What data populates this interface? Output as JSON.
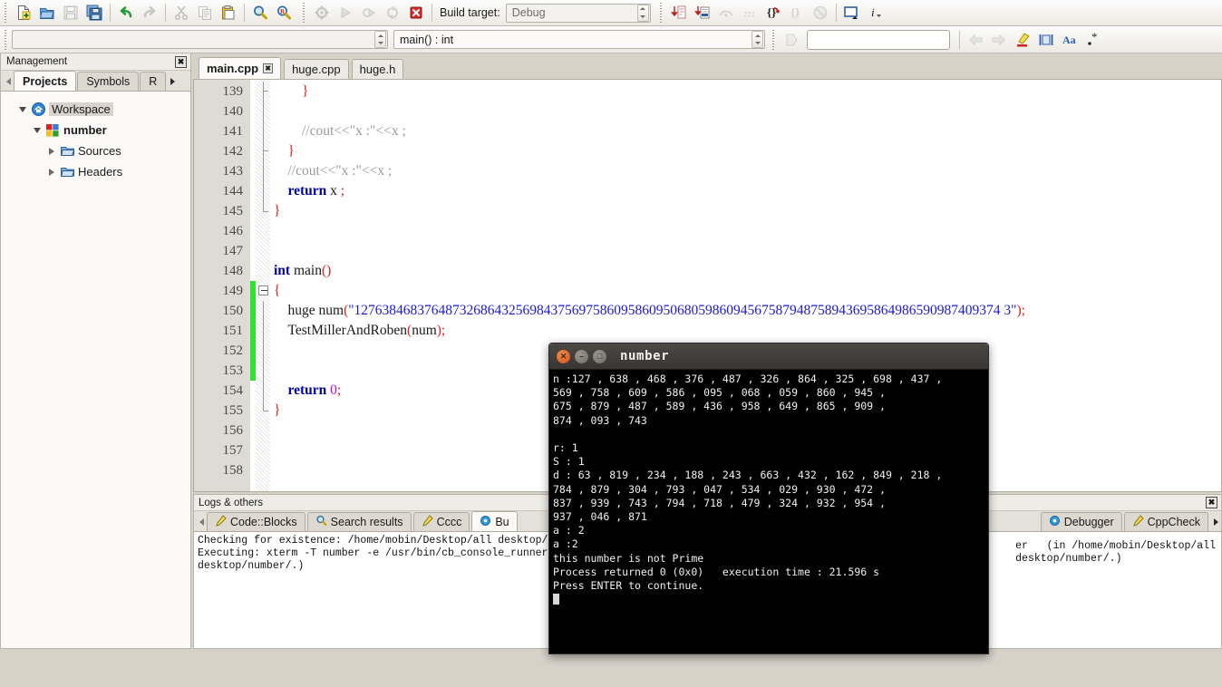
{
  "toolbar_main": {
    "buttons": [
      {
        "name": "new-file-button",
        "icon": "new-file-icon",
        "disabled": false
      },
      {
        "name": "open-file-button",
        "icon": "open-folder-icon",
        "disabled": false
      },
      {
        "name": "save-button",
        "icon": "save-icon",
        "disabled": true
      },
      {
        "name": "save-all-button",
        "icon": "save-all-icon",
        "disabled": false
      },
      {
        "name": "undo-button",
        "icon": "undo-arrow-icon",
        "disabled": false
      },
      {
        "name": "redo-button",
        "icon": "redo-arrow-icon",
        "disabled": true
      },
      {
        "name": "cut-button",
        "icon": "scissors-icon",
        "disabled": true
      },
      {
        "name": "copy-button",
        "icon": "copy-icon",
        "disabled": true
      },
      {
        "name": "paste-button",
        "icon": "clipboard-paste-icon",
        "disabled": false
      },
      {
        "name": "find-button",
        "icon": "magnifier-icon",
        "disabled": false
      },
      {
        "name": "replace-button",
        "icon": "find-replace-icon",
        "disabled": false
      }
    ],
    "build_buttons": [
      {
        "name": "build-button",
        "icon": "gear-icon",
        "disabled": true
      },
      {
        "name": "run-button",
        "icon": "play-triangle-icon",
        "disabled": true
      },
      {
        "name": "build-and-run-button",
        "icon": "gear-play-icon",
        "disabled": true
      },
      {
        "name": "rebuild-button",
        "icon": "rebuild-icon",
        "disabled": true
      },
      {
        "name": "abort-button",
        "icon": "stop-red-x-icon",
        "disabled": false
      }
    ],
    "build_target_label": "Build target:",
    "build_target_value": "Debug",
    "debug_buttons": [
      {
        "name": "debug-continue-button",
        "icon": "debug-continue-icon",
        "disabled": false
      },
      {
        "name": "debug-run-to-cursor-button",
        "icon": "run-to-cursor-icon",
        "disabled": false
      },
      {
        "name": "debug-next-line-button",
        "icon": "step-over-icon",
        "disabled": true
      },
      {
        "name": "debug-next-instruction-button",
        "icon": "step-instruction-icon",
        "disabled": true
      },
      {
        "name": "debug-step-into-button",
        "icon": "step-into-icon",
        "disabled": false
      },
      {
        "name": "debug-step-out-button",
        "icon": "step-out-icon",
        "disabled": true
      },
      {
        "name": "debug-stop-button",
        "icon": "stop-debugger-icon",
        "disabled": true
      },
      {
        "name": "debug-windows-button",
        "icon": "debug-window-icon",
        "disabled": false
      },
      {
        "name": "debug-info-button",
        "icon": "info-icon",
        "disabled": false
      }
    ]
  },
  "toolbar_secondary": {
    "scope_value": "",
    "scope_placeholder": "",
    "function_value": "main() : int",
    "goto_button": "goto-icon",
    "search_value": "",
    "search_placeholder": "",
    "right_buttons": [
      {
        "name": "nav-back-button",
        "icon": "arrow-left-icon",
        "disabled": true
      },
      {
        "name": "nav-forward-button",
        "icon": "arrow-right-icon",
        "disabled": true
      },
      {
        "name": "highlight-button",
        "icon": "highlighter-pen-icon",
        "disabled": false
      },
      {
        "name": "whole-word-button",
        "icon": "whole-word-icon",
        "disabled": false
      },
      {
        "name": "match-case-button",
        "icon": "match-case-icon",
        "disabled": false
      },
      {
        "name": "regex-button",
        "icon": "regex-icon",
        "disabled": false
      }
    ]
  },
  "management": {
    "caption": "Management",
    "close_icon": "close-icon",
    "tabs": [
      {
        "label": "Projects",
        "active": true
      },
      {
        "label": "Symbols",
        "active": false
      },
      {
        "label": "R",
        "active": false
      }
    ],
    "tree": [
      {
        "label": "Workspace",
        "icon": "workspace-home-icon",
        "depth": 0,
        "twisty": "down",
        "selected": true,
        "bold": false
      },
      {
        "label": "number",
        "icon": "project-squares-icon",
        "depth": 1,
        "twisty": "down",
        "selected": false,
        "bold": true
      },
      {
        "label": "Sources",
        "icon": "folder-icon",
        "depth": 2,
        "twisty": "right",
        "selected": false,
        "bold": false
      },
      {
        "label": "Headers",
        "icon": "folder-icon",
        "depth": 2,
        "twisty": "right",
        "selected": false,
        "bold": false
      }
    ]
  },
  "editor": {
    "tabs": [
      {
        "label": "main.cpp",
        "active": true,
        "closable": true
      },
      {
        "label": "huge.cpp",
        "active": false,
        "closable": false
      },
      {
        "label": "huge.h",
        "active": false,
        "closable": false
      }
    ],
    "first_line_number": 139,
    "lines": [
      {
        "n": 139,
        "changed": false,
        "fold": "end-inner",
        "tokens": [
          {
            "t": "        ",
            "c": "id"
          },
          {
            "t": "}",
            "c": "br"
          }
        ]
      },
      {
        "n": 140,
        "changed": false,
        "fold": "line",
        "tokens": []
      },
      {
        "n": 141,
        "changed": false,
        "fold": "line",
        "tokens": [
          {
            "t": "        //cout<<\"x :\"<<x ;",
            "c": "cm"
          }
        ]
      },
      {
        "n": 142,
        "changed": false,
        "fold": "end-inner",
        "tokens": [
          {
            "t": "    ",
            "c": "id"
          },
          {
            "t": "}",
            "c": "br"
          }
        ]
      },
      {
        "n": 143,
        "changed": false,
        "fold": "line",
        "tokens": [
          {
            "t": "    //cout<<\"x :\"<<x ;",
            "c": "cm"
          }
        ]
      },
      {
        "n": 144,
        "changed": false,
        "fold": "line",
        "tokens": [
          {
            "t": "    ",
            "c": "id"
          },
          {
            "t": "return",
            "c": "kw"
          },
          {
            "t": " x ",
            "c": "id"
          },
          {
            "t": ";",
            "c": "br"
          }
        ]
      },
      {
        "n": 145,
        "changed": false,
        "fold": "end-outer",
        "tokens": [
          {
            "t": "",
            "c": "id"
          },
          {
            "t": "}",
            "c": "br"
          }
        ]
      },
      {
        "n": 146,
        "changed": false,
        "fold": "none",
        "tokens": []
      },
      {
        "n": 147,
        "changed": false,
        "fold": "none",
        "tokens": []
      },
      {
        "n": 148,
        "changed": false,
        "fold": "none",
        "tokens": [
          {
            "t": "int",
            "c": "kw"
          },
          {
            "t": " main",
            "c": "id"
          },
          {
            "t": "()",
            "c": "br"
          }
        ]
      },
      {
        "n": 149,
        "changed": true,
        "fold": "start",
        "tokens": [
          {
            "t": "{",
            "c": "br"
          }
        ]
      },
      {
        "n": 150,
        "changed": true,
        "fold": "line",
        "tokens": [
          {
            "t": "    huge num",
            "c": "id"
          },
          {
            "t": "(",
            "c": "br"
          },
          {
            "t": "\"12763846837648732686432569843756975860958609506805986094567587948758943695864986590987409374 3\"",
            "c": "str"
          },
          {
            "t": ");",
            "c": "br"
          }
        ]
      },
      {
        "n": 151,
        "changed": true,
        "fold": "line",
        "tokens": [
          {
            "t": "    TestMillerAndRoben",
            "c": "id"
          },
          {
            "t": "(",
            "c": "br"
          },
          {
            "t": "num",
            "c": "id"
          },
          {
            "t": ");",
            "c": "br"
          }
        ]
      },
      {
        "n": 152,
        "changed": true,
        "fold": "line",
        "tokens": []
      },
      {
        "n": 153,
        "changed": true,
        "fold": "line",
        "tokens": []
      },
      {
        "n": 154,
        "changed": false,
        "fold": "line",
        "tokens": [
          {
            "t": "    ",
            "c": "id"
          },
          {
            "t": "return",
            "c": "kw"
          },
          {
            "t": " ",
            "c": "id"
          },
          {
            "t": "0",
            "c": "num"
          },
          {
            "t": ";",
            "c": "br"
          }
        ]
      },
      {
        "n": 155,
        "changed": false,
        "fold": "end-outer",
        "tokens": [
          {
            "t": "}",
            "c": "br"
          }
        ]
      },
      {
        "n": 156,
        "changed": false,
        "fold": "none",
        "tokens": []
      },
      {
        "n": 157,
        "changed": false,
        "fold": "none",
        "tokens": []
      },
      {
        "n": 158,
        "changed": false,
        "fold": "none",
        "tokens": []
      }
    ]
  },
  "terminal": {
    "title": "number",
    "close_icon": "close-icon",
    "minimize_icon": "minimize-icon",
    "maximize_icon": "maximize-icon",
    "output": "n :127 , 638 , 468 , 376 , 487 , 326 , 864 , 325 , 698 , 437 ,\n569 , 758 , 609 , 586 , 095 , 068 , 059 , 860 , 945 ,\n675 , 879 , 487 , 589 , 436 , 958 , 649 , 865 , 909 ,\n874 , 093 , 743\n\nr: 1\nS : 1\nd : 63 , 819 , 234 , 188 , 243 , 663 , 432 , 162 , 849 , 218 ,\n784 , 879 , 304 , 793 , 047 , 534 , 029 , 930 , 472 ,\n837 , 939 , 743 , 794 , 718 , 479 , 324 , 932 , 954 ,\n937 , 046 , 871\na : 2\na :2\nthis number is not Prime\nProcess returned 0 (0x0)   execution time : 21.596 s\nPress ENTER to continue."
  },
  "logs": {
    "caption": "Logs & others",
    "close_icon": "close-icon",
    "tabs": [
      {
        "label": "Code::Blocks",
        "icon": "pencil-icon",
        "active": false
      },
      {
        "label": "Search results",
        "icon": "magnifier-icon",
        "active": false
      },
      {
        "label": "Cccc",
        "icon": "pencil-icon",
        "active": false
      },
      {
        "label": "Bu",
        "icon": "build-log-icon",
        "active": true
      }
    ],
    "right_tabs": [
      {
        "label": "Debugger",
        "icon": "debugger-icon",
        "active": false
      },
      {
        "label": "CppCheck",
        "icon": "pencil-icon",
        "active": false
      }
    ],
    "body": "Checking for existence: /home/mobin/Desktop/all desktop/number/b\nExecuting: xterm -T number -e /usr/bin/cb_console_runner LD_LIBRA\ndesktop/number/.)",
    "body_right": "er   (in /home/mobin/Desktop/all\ndesktop/number/.)"
  },
  "colors": {
    "accent_green": "#33e033",
    "string_blue": "#1a1ae0",
    "keyword_blue": "#0000b0",
    "brace_red": "#e02020",
    "comment_gray": "#9a9a9a",
    "number_magenta": "#cc00cc",
    "terminal_bg": "#000000"
  }
}
